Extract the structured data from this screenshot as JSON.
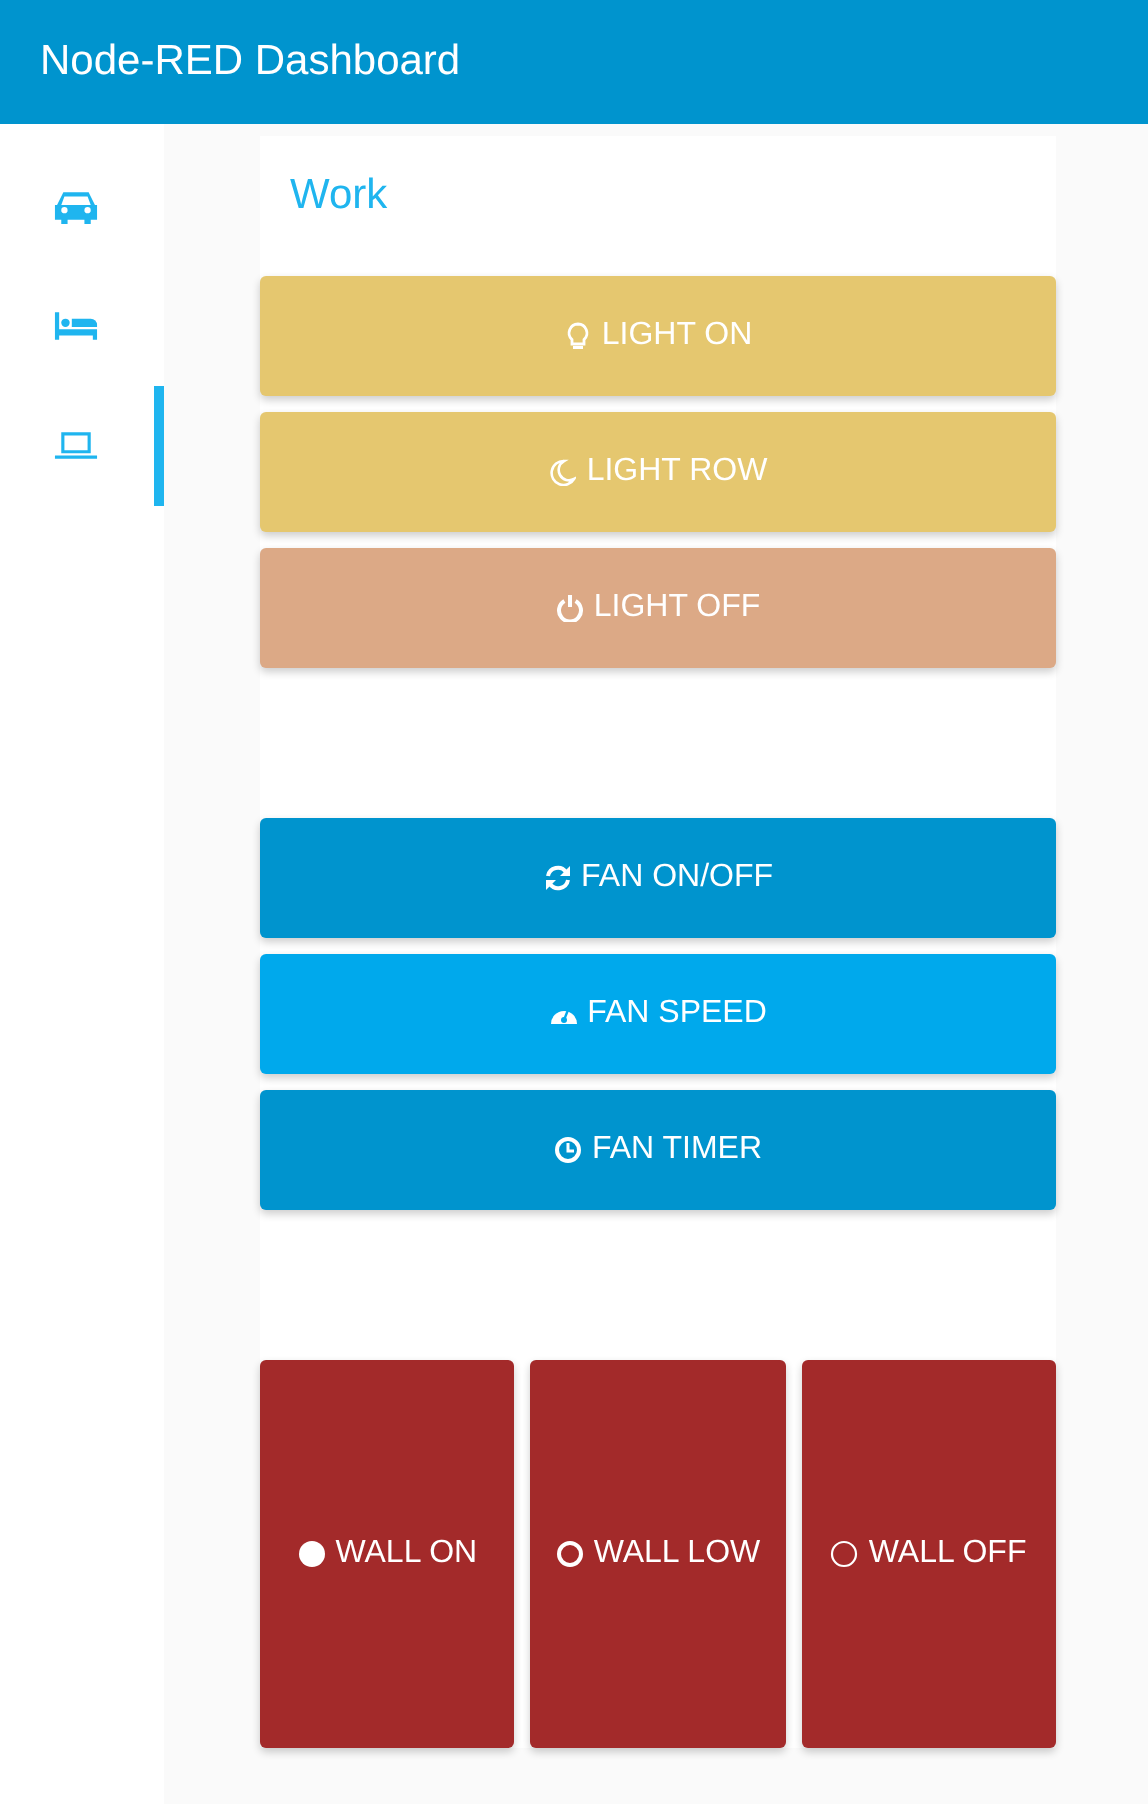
{
  "header": {
    "title": "Node-RED Dashboard"
  },
  "nav": [
    {
      "selected": false
    },
    {
      "selected": false
    },
    {
      "selected": true
    }
  ],
  "group": {
    "title": "Work",
    "sections": [
      {
        "kind": "stack",
        "buttons": [
          {
            "label": "LIGHT ON",
            "color": "#e5c76f"
          },
          {
            "label": "LIGHT ROW",
            "color": "#e5c76f"
          },
          {
            "label": "LIGHT OFF",
            "color": "#dca986"
          }
        ]
      },
      {
        "kind": "stack",
        "buttons": [
          {
            "label": "FAN ON/OFF",
            "color": "#0094ce"
          },
          {
            "label": "FAN SPEED",
            "color": "#00a9ec"
          },
          {
            "label": "FAN TIMER",
            "color": "#0094ce"
          }
        ]
      },
      {
        "kind": "row",
        "buttons": [
          {
            "label": "WALL ON",
            "color": "#a32a2a"
          },
          {
            "label": "WALL LOW",
            "color": "#a32a2a"
          },
          {
            "label": "WALL OFF",
            "color": "#a32a2a"
          }
        ]
      }
    ]
  }
}
